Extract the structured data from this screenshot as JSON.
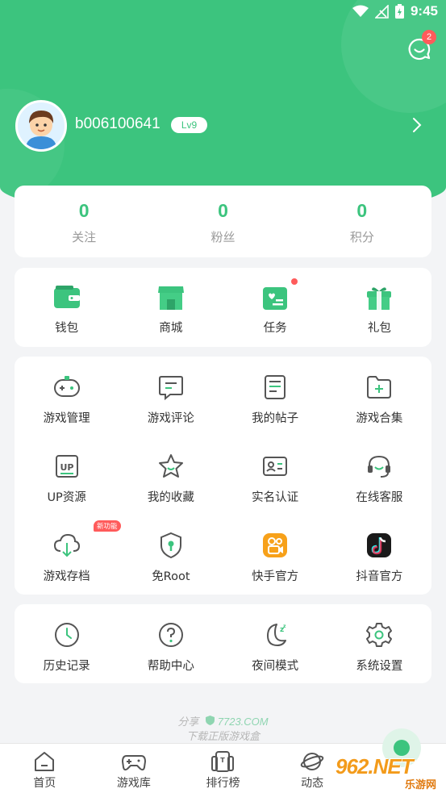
{
  "status_bar": {
    "time": "9:45"
  },
  "messages": {
    "badge_count": "2"
  },
  "profile": {
    "username": "b006100641",
    "level": "Lv9"
  },
  "stats": [
    {
      "value": "0",
      "label": "关注"
    },
    {
      "value": "0",
      "label": "粉丝"
    },
    {
      "value": "0",
      "label": "积分"
    }
  ],
  "quick_actions": [
    {
      "label": "钱包",
      "icon": "wallet-icon"
    },
    {
      "label": "商城",
      "icon": "store-icon"
    },
    {
      "label": "任务",
      "icon": "task-icon"
    },
    {
      "label": "礼包",
      "icon": "gift-icon"
    }
  ],
  "tools": [
    {
      "label": "游戏管理",
      "icon": "gamepad-icon"
    },
    {
      "label": "游戏评论",
      "icon": "comment-icon"
    },
    {
      "label": "我的帖子",
      "icon": "post-icon"
    },
    {
      "label": "游戏合集",
      "icon": "folder-plus-icon"
    },
    {
      "label": "UP资源",
      "icon": "up-icon"
    },
    {
      "label": "我的收藏",
      "icon": "star-icon"
    },
    {
      "label": "实名认证",
      "icon": "id-card-icon"
    },
    {
      "label": "在线客服",
      "icon": "headset-icon"
    },
    {
      "label": "游戏存档",
      "icon": "cloud-download-icon"
    },
    {
      "label": "免Root",
      "icon": "shield-icon"
    },
    {
      "label": "快手官方",
      "icon": "kuaishou-icon"
    },
    {
      "label": "抖音官方",
      "icon": "douyin-icon"
    }
  ],
  "new_feature_badge": "新功能",
  "more": [
    {
      "label": "历史记录",
      "icon": "clock-icon"
    },
    {
      "label": "帮助中心",
      "icon": "help-icon"
    },
    {
      "label": "夜间模式",
      "icon": "moon-icon"
    },
    {
      "label": "系统设置",
      "icon": "gear-icon"
    }
  ],
  "share": {
    "prefix": "分享",
    "brand": "7723.COM",
    "subtitle": "下载正版游戏盒"
  },
  "nav": [
    {
      "label": "首页",
      "icon": "home-icon"
    },
    {
      "label": "游戏库",
      "icon": "game-library-icon"
    },
    {
      "label": "排行榜",
      "icon": "ranking-icon"
    },
    {
      "label": "动态",
      "icon": "planet-icon"
    }
  ],
  "watermark": {
    "main": "962.NET",
    "sub": "乐游网"
  },
  "colors": {
    "accent": "#3cc47e",
    "badge": "#ff5b5b",
    "background": "#f3f4f6"
  }
}
